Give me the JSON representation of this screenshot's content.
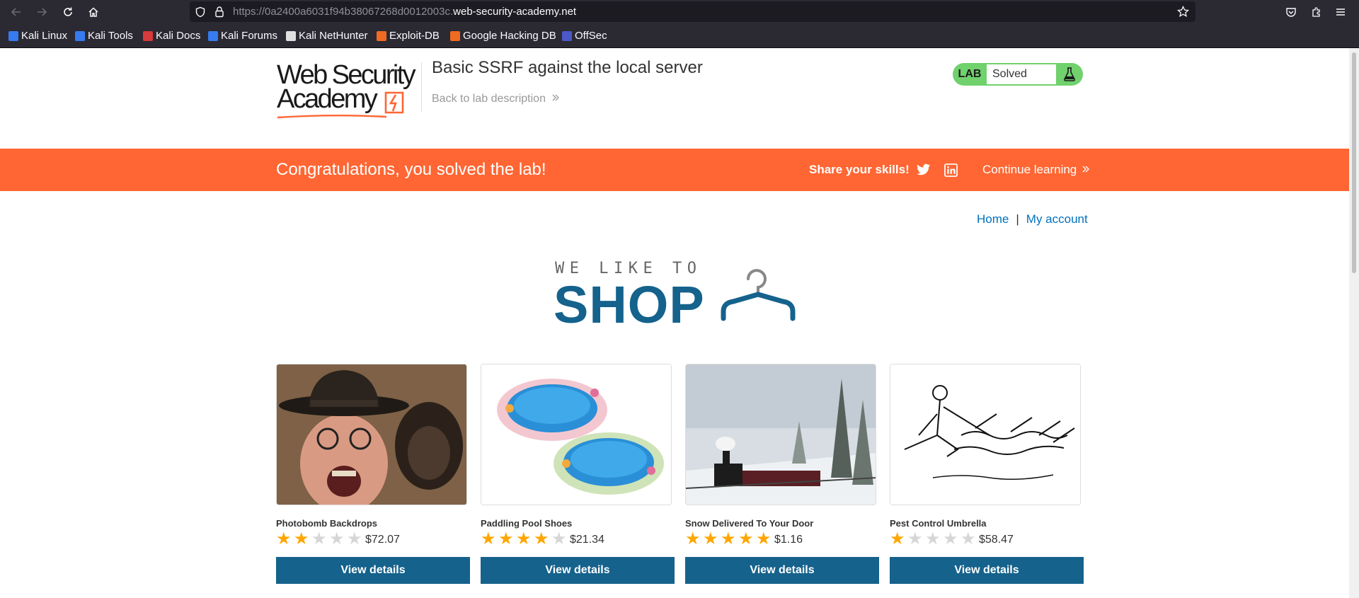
{
  "browser": {
    "url_prefix": "https://0a2400a6031f94b38067268d0012003c.",
    "url_domain": "web-security-academy.net",
    "bookmarks": [
      {
        "label": "Kali Linux",
        "color": "#367bf0"
      },
      {
        "label": "Kali Tools",
        "color": "#367bf0"
      },
      {
        "label": "Kali Docs",
        "color": "#d63a3a"
      },
      {
        "label": "Kali Forums",
        "color": "#367bf0"
      },
      {
        "label": "Kali NetHunter",
        "color": "#e0e0e0"
      },
      {
        "label": "Exploit-DB",
        "color": "#f06a22"
      },
      {
        "label": "Google Hacking DB",
        "color": "#f06a22"
      },
      {
        "label": "OffSec",
        "color": "#4a58c8"
      }
    ]
  },
  "header": {
    "logo_line1": "Web Security",
    "logo_line2": "Academy",
    "lab_title": "Basic SSRF against the local server",
    "back_link": "Back to lab description"
  },
  "lab_status": {
    "tag": "LAB",
    "state": "Solved"
  },
  "banner": {
    "message": "Congratulations, you solved the lab!",
    "share_label": "Share your skills!",
    "continue_label": "Continue learning"
  },
  "nav": {
    "home": "Home",
    "separator": "|",
    "account": "My account"
  },
  "shop_logo": {
    "tagline": "WE LIKE TO",
    "word": "SHOP"
  },
  "products": [
    {
      "name": "Photobomb Backdrops",
      "price": "$72.07",
      "rating": 2,
      "button": "View details"
    },
    {
      "name": "Paddling Pool Shoes",
      "price": "$21.34",
      "rating": 4,
      "button": "View details"
    },
    {
      "name": "Snow Delivered To Your Door",
      "price": "$1.16",
      "rating": 5,
      "button": "View details"
    },
    {
      "name": "Pest Control Umbrella",
      "price": "$58.47",
      "rating": 1,
      "button": "View details"
    }
  ],
  "colors": {
    "accent_orange": "#ff6633",
    "primary_blue": "#15628c",
    "link_blue": "#0071bc",
    "lab_green": "#70d16d",
    "star_gold": "#ffa600"
  }
}
